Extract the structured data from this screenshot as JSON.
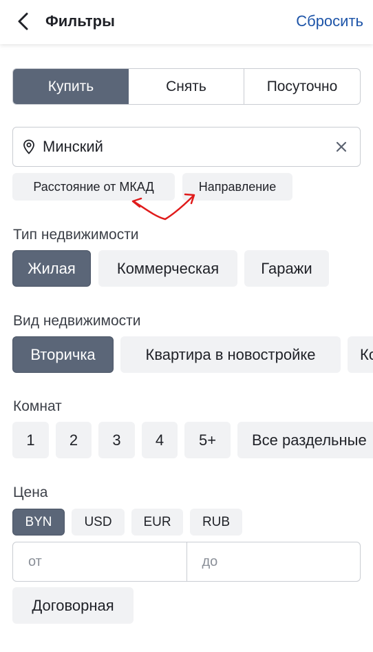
{
  "header": {
    "title": "Фильтры",
    "reset_label": "Сбросить"
  },
  "deal_types": [
    "Купить",
    "Снять",
    "Посуточно"
  ],
  "location": {
    "value": "Минский"
  },
  "location_options": [
    "Расстояние от МКАД",
    "Направление"
  ],
  "property_type": {
    "label": "Тип недвижимости",
    "options": [
      "Жилая",
      "Коммерческая",
      "Гаражи"
    ],
    "selected": "Жилая"
  },
  "property_kind": {
    "label": "Вид недвижимости",
    "options": [
      "Вторичка",
      "Квартира в новостройке",
      "Ко"
    ],
    "selected": "Вторичка"
  },
  "rooms": {
    "label": "Комнат",
    "options": [
      "1",
      "2",
      "3",
      "4",
      "5+",
      "Все раздельные"
    ]
  },
  "price": {
    "label": "Цена",
    "currencies": [
      "BYN",
      "USD",
      "EUR",
      "RUB"
    ],
    "selected_currency": "BYN",
    "from_placeholder": "от",
    "to_placeholder": "до",
    "negotiable_label": "Договорная"
  },
  "colors": {
    "accent": "#1d54a8",
    "selected_chip": "#5b6678",
    "chip_bg": "#f1f2f4",
    "annotation": "#e01b1b"
  }
}
